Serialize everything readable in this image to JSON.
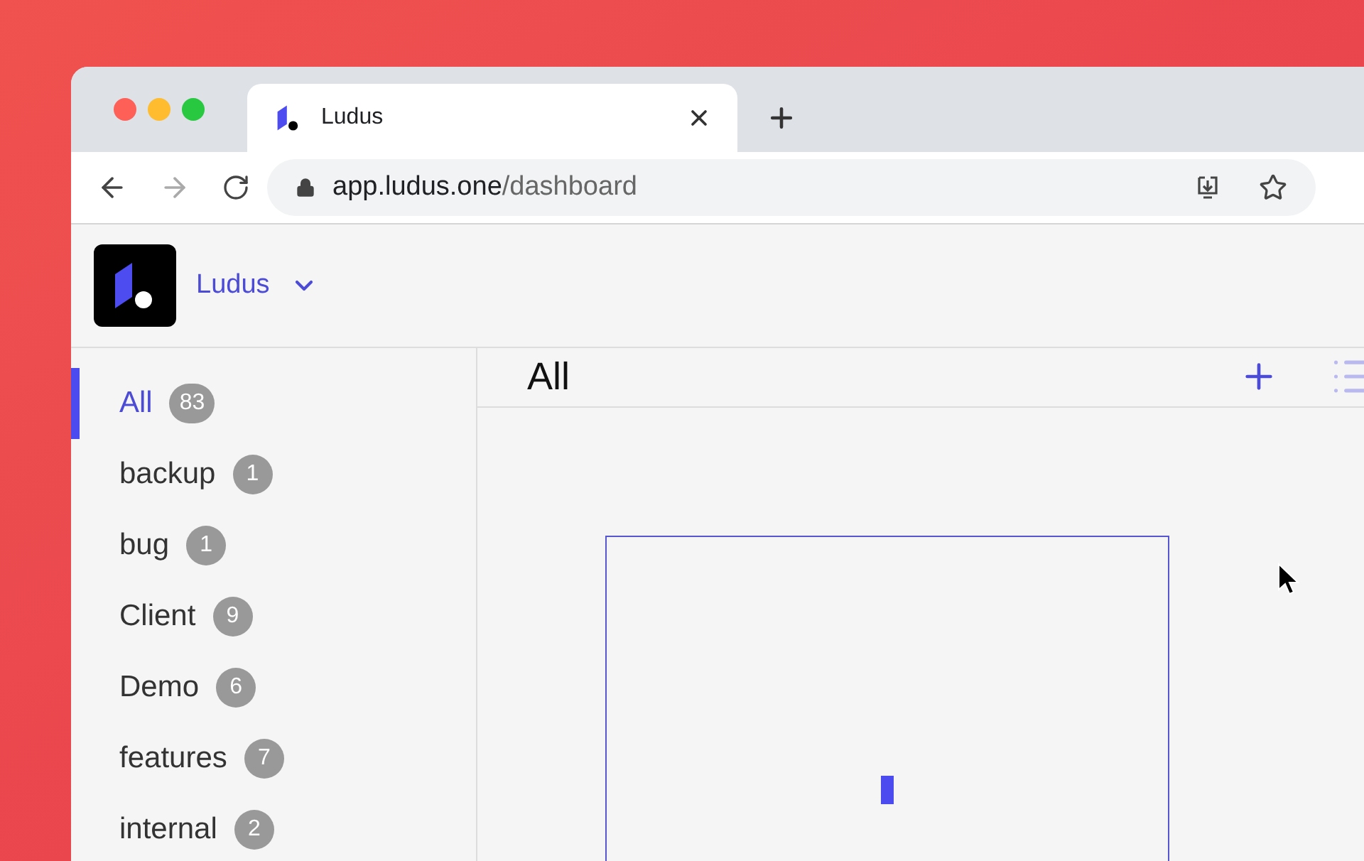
{
  "browser": {
    "tab": {
      "title": "Ludus"
    },
    "address": {
      "domain": "app.ludus.one",
      "path": "/dashboard"
    }
  },
  "workspace": {
    "name": "Ludus"
  },
  "sidebar": {
    "items": [
      {
        "label": "All",
        "count": "83",
        "selected": true
      },
      {
        "label": "backup",
        "count": "1",
        "selected": false
      },
      {
        "label": "bug",
        "count": "1",
        "selected": false
      },
      {
        "label": "Client",
        "count": "9",
        "selected": false
      },
      {
        "label": "Demo",
        "count": "6",
        "selected": false
      },
      {
        "label": "features",
        "count": "7",
        "selected": false
      },
      {
        "label": "internal",
        "count": "2",
        "selected": false
      }
    ]
  },
  "main": {
    "title": "All"
  }
}
